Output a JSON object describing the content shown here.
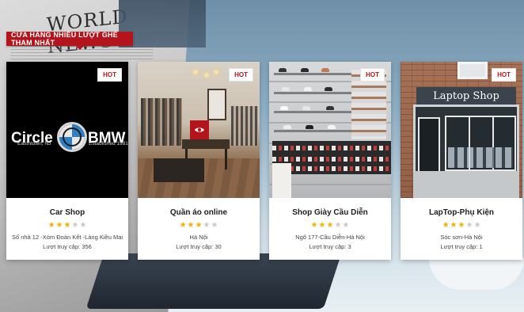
{
  "section": {
    "title": "CỬA HÀNG NHIỀU LƯỢT GHÉ THAM NHẤT"
  },
  "background": {
    "newspaper_title": "WORLD NEWS"
  },
  "colors": {
    "accent_red": "#b4141b",
    "star_on": "#f2b200",
    "star_off": "#c9c9c9"
  },
  "shops": [
    {
      "badge": "HOT",
      "name": "Car Shop",
      "rating": 3,
      "address": "Số nhà 12 -Xóm Đoàn Kết -Làng Kiều Mai",
      "visits": "Lượt truy cập: 356",
      "image": {
        "brand_left": "Circle",
        "brand_right": "BMW",
        "logo_text": "BMW",
        "caption_left": "Eatontown, NJ",
        "caption_right": "Established 1981"
      }
    },
    {
      "badge": "HOT",
      "name": "Quần áo online",
      "rating": 3,
      "address": "Hà Nội",
      "visits": "Lượt truy cập: 30",
      "hover_icon": "eye-icon"
    },
    {
      "badge": "HOT",
      "name": "Shop Giày Cầu Diễn",
      "rating": 3,
      "address": "Ngõ 177-Cầu Diễn-Hà Nội",
      "visits": "Lượt truy cập: 3"
    },
    {
      "badge": "HOT",
      "name": "LapTop-Phụ Kiện",
      "rating": 3,
      "address": "Sóc sơn-Hà Nội",
      "visits": "Lượt truy cập: 1",
      "image": {
        "sign": "Laptop Shop"
      }
    }
  ]
}
